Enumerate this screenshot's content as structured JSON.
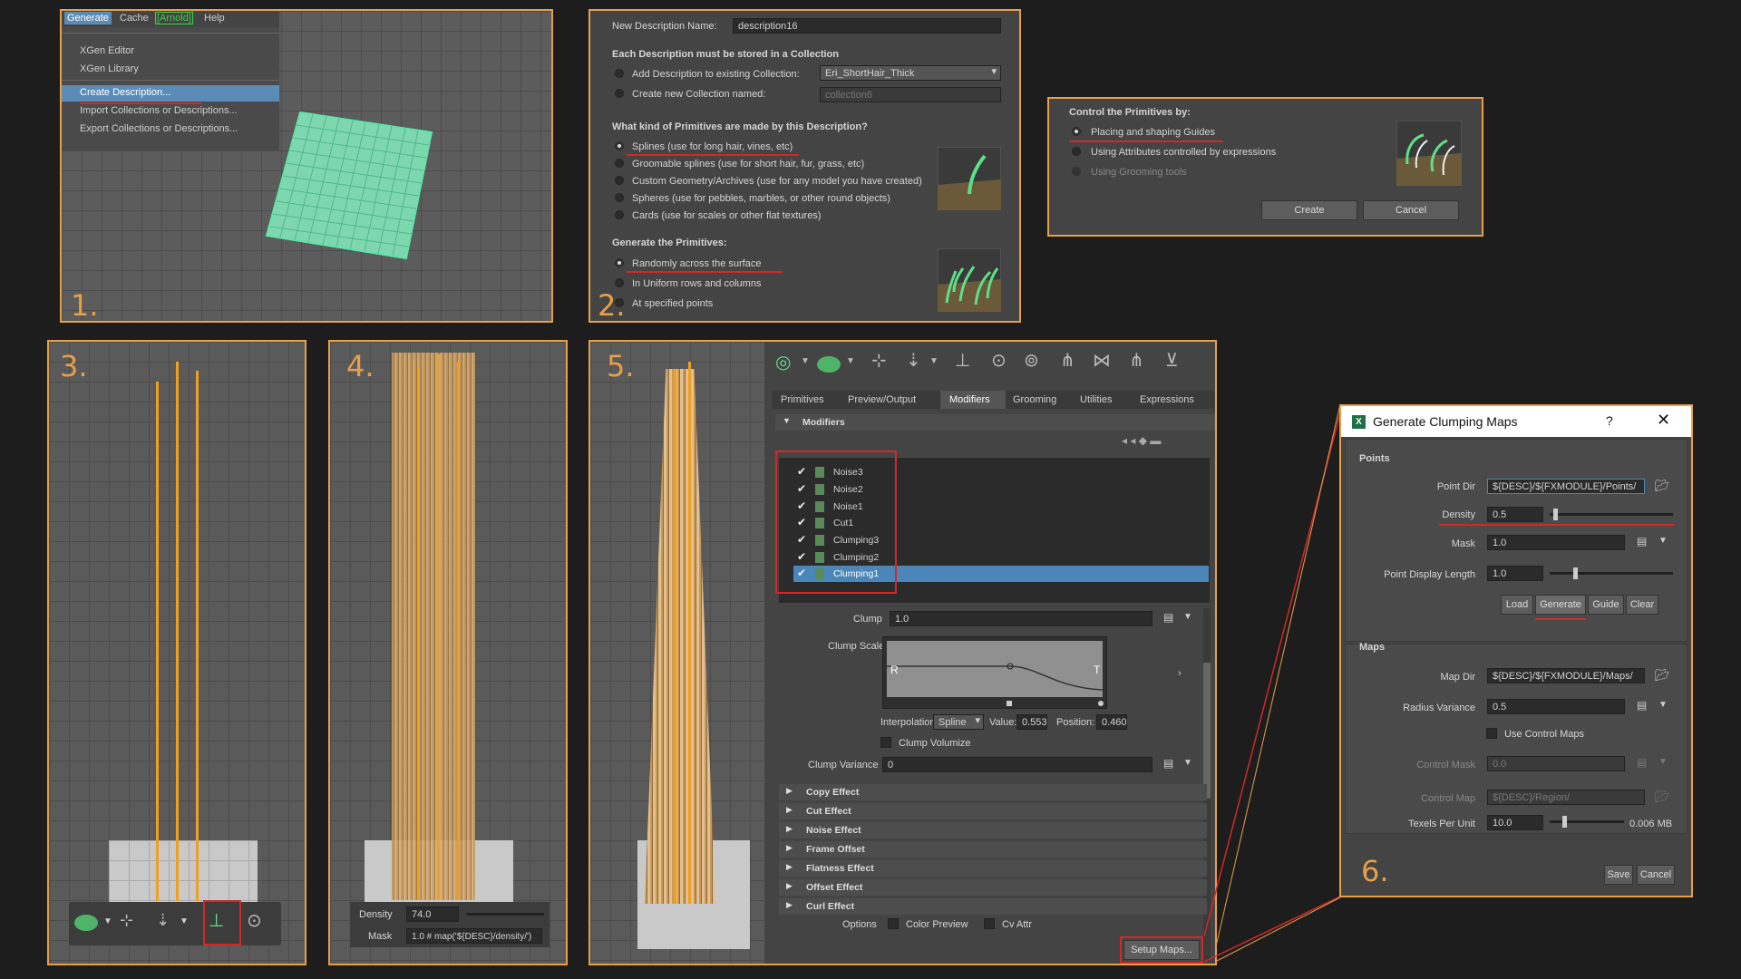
{
  "panel_labels": {
    "p1": "1.",
    "p2": "2.",
    "p3": "3.",
    "p4": "4.",
    "p5": "5.",
    "p6": "6."
  },
  "p1": {
    "menubar": {
      "generate": "Generate",
      "cache": "Cache",
      "arnold": "[Arnold]",
      "help": "Help"
    },
    "menu_items": [
      "XGen Editor",
      "XGen Library",
      "Create Description...",
      "Import Collections or Descriptions...",
      "Export Collections or Descriptions..."
    ]
  },
  "p2": {
    "name_label": "New Description Name:",
    "name_value": "description16",
    "collection_heading": "Each Description must be stored in a Collection",
    "add_existing_label": "Add Description to existing Collection:",
    "existing_value": "Eri_ShortHair_Thick",
    "create_new_label": "Create new Collection named:",
    "new_value": "collection6",
    "primitives_heading": "What kind of Primitives are made by this Description?",
    "primitives": [
      "Splines (use for long hair, vines, etc)",
      "Groomable splines (use for short hair, fur, grass, etc)",
      "Custom Geometry/Archives (use for any model you have created)",
      "Spheres (use for pebbles, marbles, or other round objects)",
      "Cards (use for scales or other flat textures)"
    ],
    "generate_heading": "Generate the Primitives:",
    "generate_options": [
      "Randomly across the surface",
      "In Uniform rows and columns",
      "At specified points"
    ]
  },
  "p2b": {
    "heading": "Control the Primitives by:",
    "options": [
      "Placing and shaping Guides",
      "Using Attributes controlled by expressions",
      "Using Grooming tools"
    ],
    "create": "Create",
    "cancel": "Cancel"
  },
  "p4": {
    "density_label": "Density",
    "density_value": "74.0",
    "mask_label": "Mask",
    "mask_value": "1.0 # map('${DESC}/density/')"
  },
  "p5": {
    "tabs": [
      "Primitives",
      "Preview/Output",
      "Modifiers",
      "Grooming",
      "Utilities",
      "Expressions"
    ],
    "active_tab": "Modifiers",
    "modifiers_heading": "Modifiers",
    "modifiers": [
      "Noise3",
      "Noise2",
      "Noise1",
      "Cut1",
      "Clumping3",
      "Clumping2",
      "Clumping1"
    ],
    "selected_modifier": "Clumping1",
    "clump_label": "Clump",
    "clump_value": "1.0",
    "clump_scale_label": "Clump Scale",
    "ramp_left": "R",
    "ramp_right": "T",
    "interpolation_label": "Interpolation:",
    "interpolation_value": "Spline",
    "value_label": "Value:",
    "value_value": "0.553",
    "position_label": "Position:",
    "position_value": "0.460",
    "clump_volumize": "Clump Volumize",
    "clump_variance_label": "Clump Variance",
    "clump_variance_value": "0",
    "effects": [
      "Copy Effect",
      "Cut Effect",
      "Noise Effect",
      "Frame Offset",
      "Flatness Effect",
      "Offset Effect",
      "Curl Effect"
    ],
    "options_label": "Options",
    "color_preview": "Color Preview",
    "cv_attr": "Cv Attr",
    "setup_maps": "Setup Maps..."
  },
  "p6": {
    "title": "Generate Clumping Maps",
    "help": "?",
    "points_heading": "Points",
    "point_dir_label": "Point Dir",
    "point_dir_value": "${DESC}/${FXMODULE}/Points/",
    "density_label": "Density",
    "density_value": "0.5",
    "mask_label": "Mask",
    "mask_value": "1.0",
    "pdl_label": "Point Display Length",
    "pdl_value": "1.0",
    "buttons": [
      "Load",
      "Generate",
      "Guide",
      "Clear"
    ],
    "maps_heading": "Maps",
    "map_dir_label": "Map Dir",
    "map_dir_value": "${DESC}/${FXMODULE}/Maps/",
    "radius_label": "Radius Variance",
    "radius_value": "0.5",
    "use_control_maps": "Use Control Maps",
    "control_mask_label": "Control Mask",
    "control_mask_value": "0.0",
    "control_map_label": "Control Map",
    "control_map_value": "${DESC}/Region/",
    "tpu_label": "Texels Per Unit",
    "tpu_value": "10.0",
    "tpu_size": "0.006 MB",
    "save": "Save",
    "cancel": "Cancel"
  },
  "colors": {
    "accent": "#e6a04a",
    "highlight": "#d12828",
    "selection": "#4a86b8",
    "hair": "#f0a020"
  }
}
